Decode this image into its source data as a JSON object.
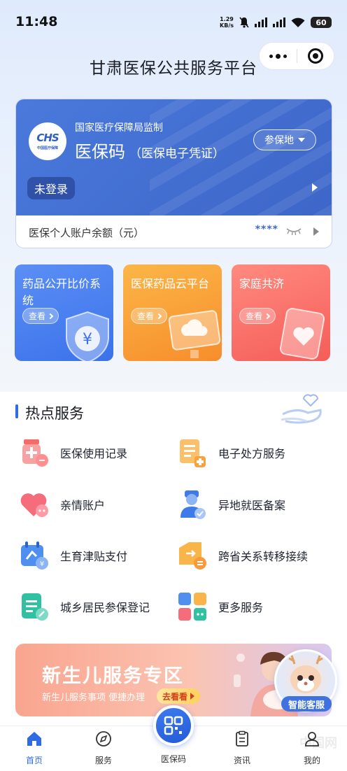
{
  "status_bar": {
    "time": "11:48",
    "net_speed_value": "1.29",
    "net_speed_unit": "KB/s",
    "battery": "60"
  },
  "header": {
    "title": "甘肃医保公共服务平台"
  },
  "card": {
    "supervise_text": "国家医疗保障局监制",
    "name": "医保码",
    "subtitle": "（医保电子凭证）",
    "place_button": "参保地",
    "login_status": "未登录",
    "balance_label": "医保个人账户余额（元）",
    "balance_masked": "****",
    "logo_text": "CHS",
    "logo_sub": "中国医疗保障",
    "colors": {
      "card_blue": "#4a79dc"
    }
  },
  "promos": [
    {
      "title": "药品公开比价系统",
      "button": "查看"
    },
    {
      "title": "医保药品云平台",
      "button": "查看"
    },
    {
      "title": "家庭共济",
      "button": "查看"
    }
  ],
  "hot_services": {
    "title": "热点服务",
    "items": [
      {
        "label": "医保使用记录",
        "icon": "medicine-bottle-icon"
      },
      {
        "label": "电子处方服务",
        "icon": "prescription-icon"
      },
      {
        "label": "亲情账户",
        "icon": "heart-account-icon"
      },
      {
        "label": "异地就医备案",
        "icon": "doctor-icon"
      },
      {
        "label": "生育津贴支付",
        "icon": "calendar-allowance-icon"
      },
      {
        "label": "跨省关系转移接续",
        "icon": "transfer-box-icon"
      },
      {
        "label": "城乡居民参保登记",
        "icon": "register-form-icon"
      },
      {
        "label": "更多服务",
        "icon": "more-grid-icon"
      }
    ]
  },
  "banner": {
    "title": "新生儿服务专区",
    "subtitle": "新生儿服务事项 便捷办理",
    "button": "去看看",
    "assistant_label": "智能客服"
  },
  "tabbar": {
    "tabs": [
      {
        "label": "首页",
        "icon": "home-icon",
        "active": true
      },
      {
        "label": "服务",
        "icon": "compass-icon",
        "active": false
      },
      {
        "label": "医保码",
        "icon": "qr-code-icon",
        "active": false
      },
      {
        "label": "资讯",
        "icon": "news-icon",
        "active": false
      },
      {
        "label": "我的",
        "icon": "user-icon",
        "active": false
      }
    ],
    "accent": "#2f6be3"
  },
  "watermark": "中国网"
}
